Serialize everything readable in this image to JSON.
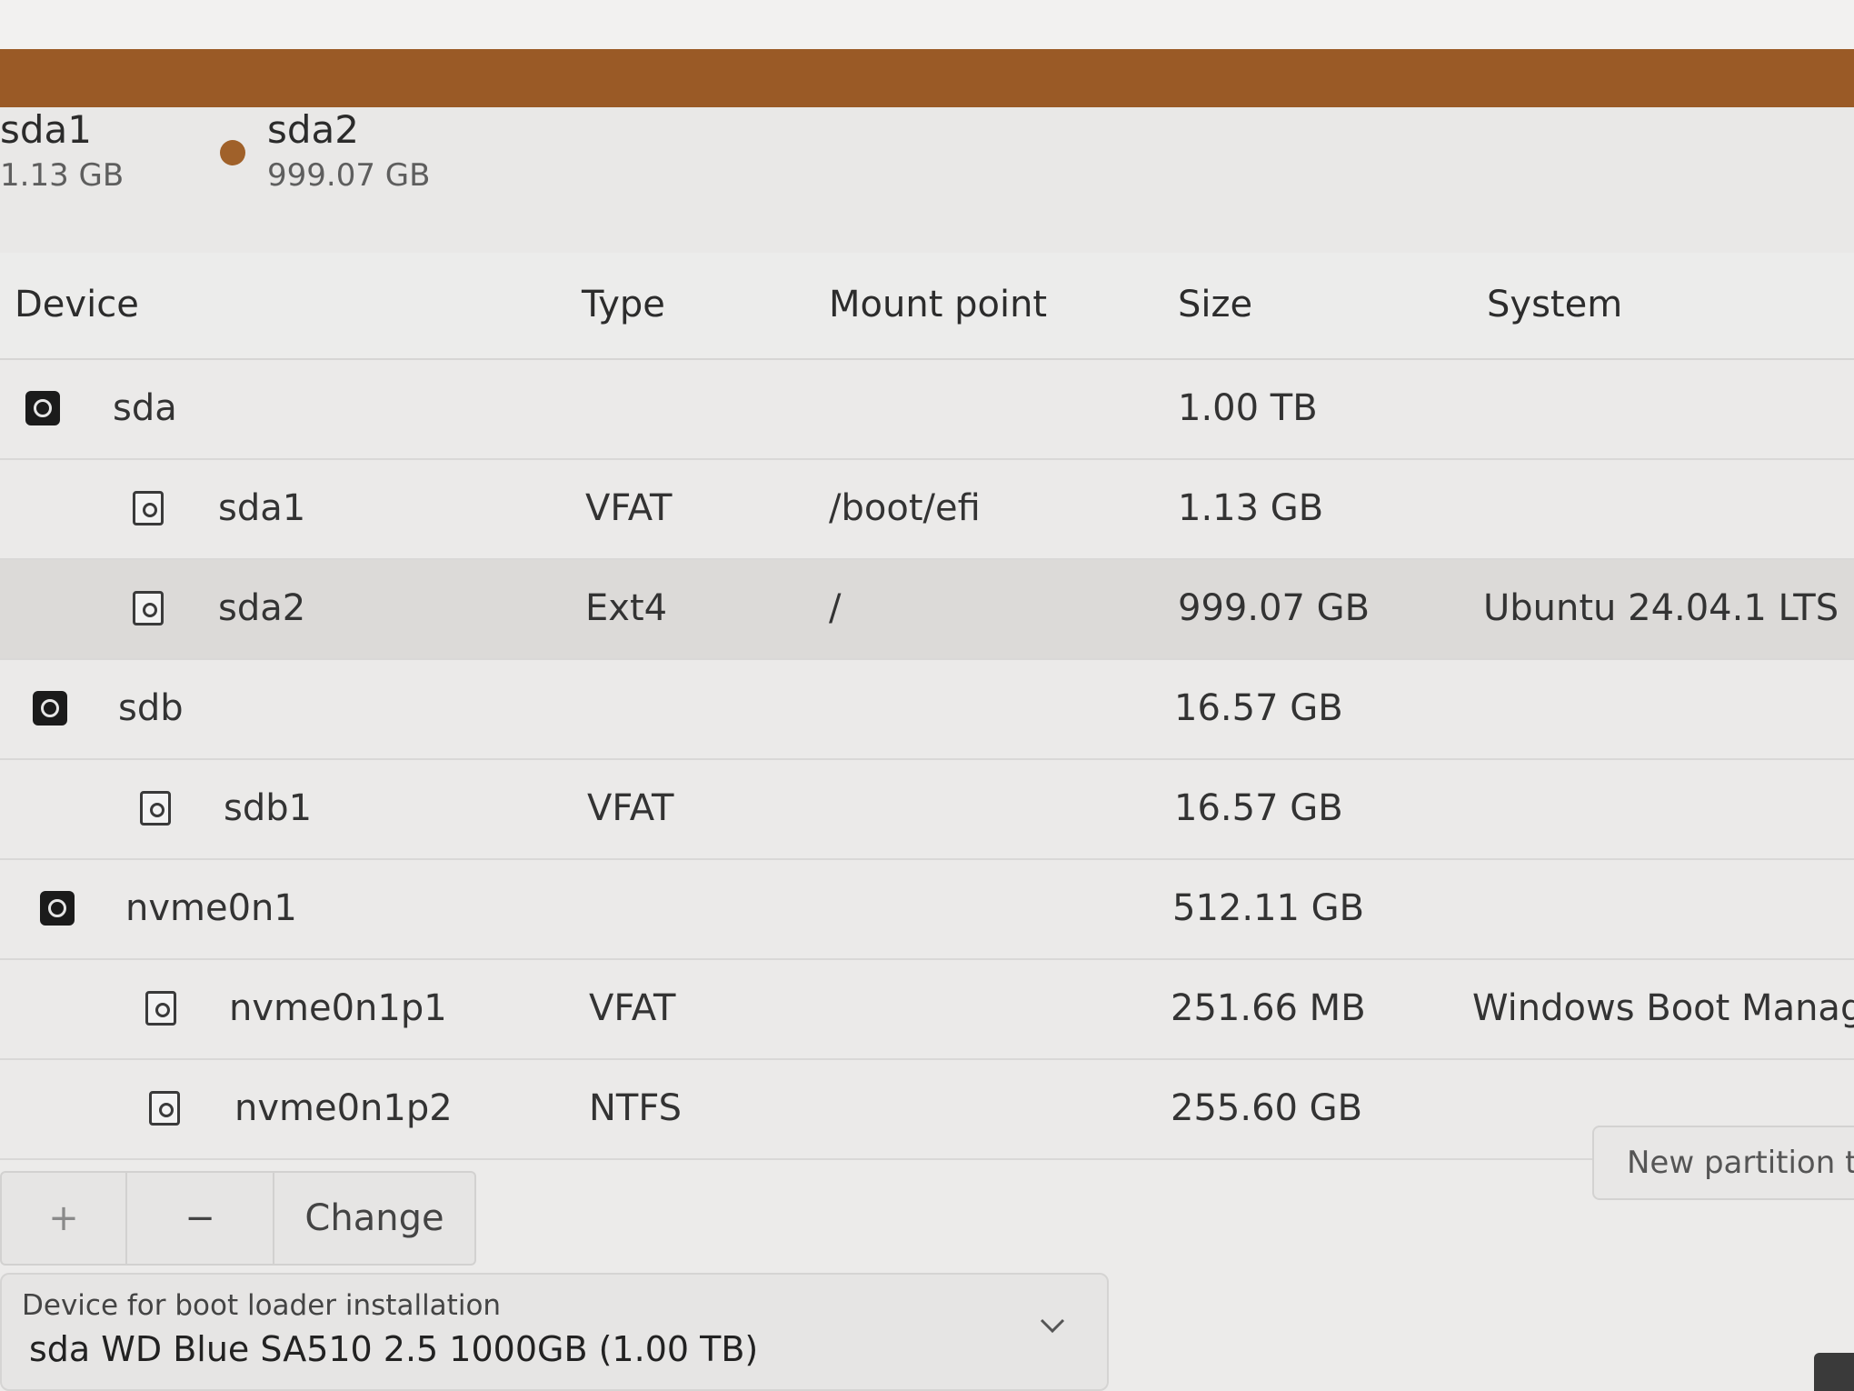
{
  "usage_legend": [
    {
      "name": "sda1",
      "size": "1.13 GB"
    },
    {
      "name": "sda2",
      "size": "999.07 GB"
    }
  ],
  "colors": {
    "sda2_usage": "#9a5a26",
    "sda2_dot": "#a0612a"
  },
  "table": {
    "headers": {
      "device": "Device",
      "type": "Type",
      "mount": "Mount point",
      "size": "Size",
      "system": "System"
    },
    "rows": [
      {
        "device": "sda",
        "type": "",
        "mount": "",
        "size": "1.00 TB",
        "system": "",
        "icon": "disk-icon"
      },
      {
        "device": "sda1",
        "type": "VFAT",
        "mount": "/boot/efi",
        "size": "1.13 GB",
        "system": "",
        "icon": "partition-icon"
      },
      {
        "device": "sda2",
        "type": "Ext4",
        "mount": "/",
        "size": "999.07 GB",
        "system": "Ubuntu 24.04.1 LTS",
        "icon": "partition-icon"
      },
      {
        "device": "sdb",
        "type": "",
        "mount": "",
        "size": "16.57 GB",
        "system": "",
        "icon": "disk-icon"
      },
      {
        "device": "sdb1",
        "type": "VFAT",
        "mount": "",
        "size": "16.57 GB",
        "system": "",
        "icon": "partition-icon"
      },
      {
        "device": "nvme0n1",
        "type": "",
        "mount": "",
        "size": "512.11 GB",
        "system": "",
        "icon": "disk-icon"
      },
      {
        "device": "nvme0n1p1",
        "type": "VFAT",
        "mount": "",
        "size": "251.66 MB",
        "system": "Windows Boot Manager",
        "icon": "partition-icon"
      },
      {
        "device": "nvme0n1p2",
        "type": "NTFS",
        "mount": "",
        "size": "255.60 GB",
        "system": "",
        "icon": "partition-icon"
      }
    ]
  },
  "toolbar": {
    "add_label": "+",
    "remove_label": "−",
    "change_label": "Change"
  },
  "new_partition_table_label": "New partition tab",
  "bootloader": {
    "label": "Device for boot loader installation",
    "value": "sda WD Blue SA510 2.5 1000GB (1.00 TB)"
  }
}
